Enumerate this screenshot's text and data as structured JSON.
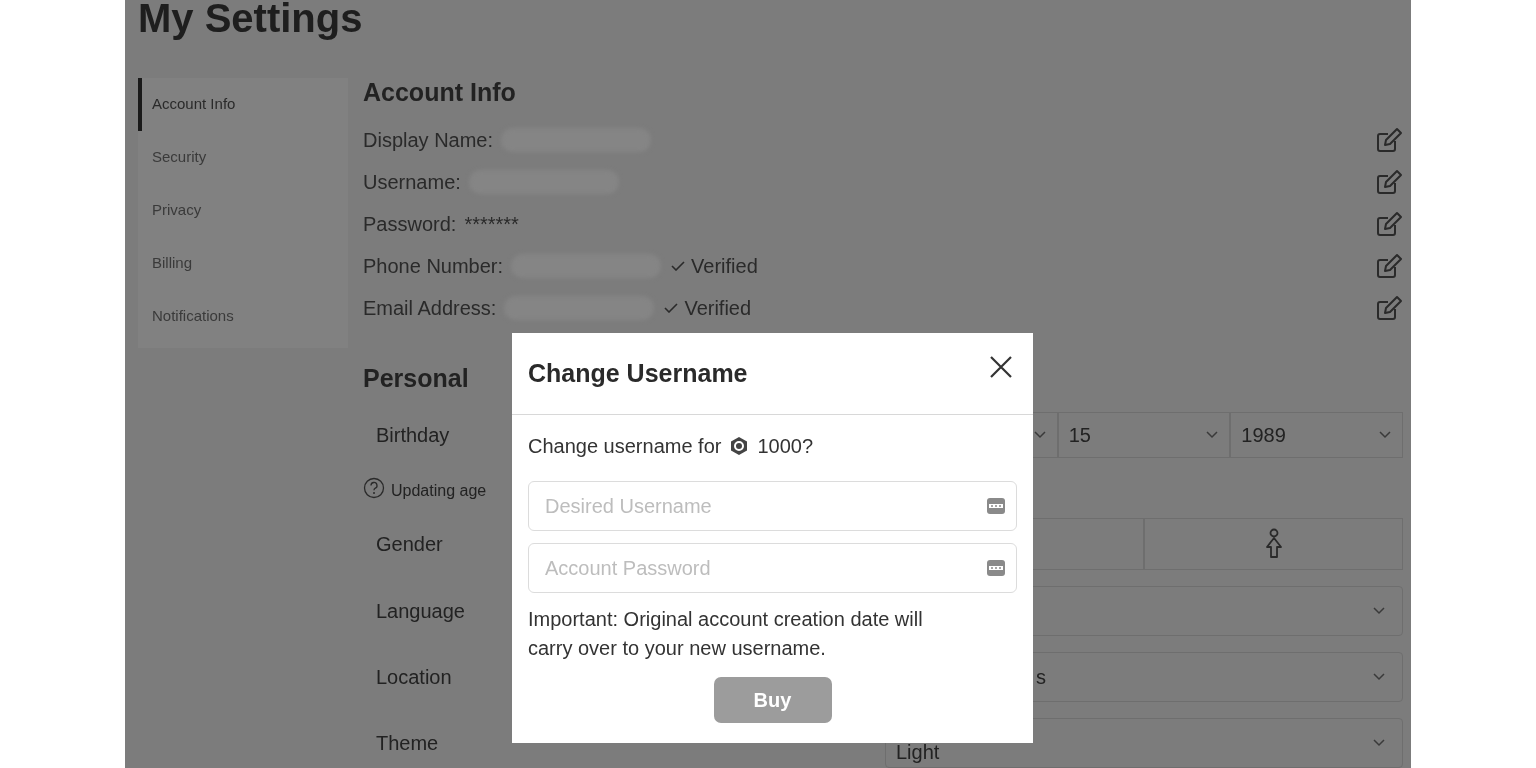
{
  "page_title": "My Settings",
  "sidebar": {
    "items": [
      {
        "label": "Account Info",
        "selected": true
      },
      {
        "label": "Security",
        "selected": false
      },
      {
        "label": "Privacy",
        "selected": false
      },
      {
        "label": "Billing",
        "selected": false
      },
      {
        "label": "Notifications",
        "selected": false
      }
    ]
  },
  "account_info": {
    "title": "Account Info",
    "rows": [
      {
        "label": "Display Name:",
        "kind": "blurred"
      },
      {
        "label": "Username:",
        "kind": "blurred"
      },
      {
        "label": "Password:",
        "kind": "text",
        "value": "*******"
      },
      {
        "label": "Phone Number:",
        "kind": "blurred",
        "verified": "Verified"
      },
      {
        "label": "Email Address:",
        "kind": "blurred",
        "verified": "Verified"
      }
    ]
  },
  "personal": {
    "title": "Personal",
    "birthday": {
      "label": "Birthday",
      "dropdowns": [
        {
          "kind": "empty"
        },
        {
          "kind": "value",
          "value": "15"
        },
        {
          "kind": "value",
          "value": "1989"
        }
      ],
      "hint": "Updating age"
    },
    "gender": {
      "label": "Gender",
      "options": [
        {
          "kind": "covered"
        },
        {
          "kind": "female"
        }
      ]
    },
    "rows": [
      {
        "label": "Language"
      },
      {
        "label": "Location",
        "value": "s"
      },
      {
        "label": "Theme",
        "value": "Light"
      }
    ]
  },
  "modal": {
    "title": "Change Username",
    "prompt": "Change username for",
    "price": "1000?",
    "fields": [
      {
        "placeholder": "Desired Username"
      },
      {
        "placeholder": "Account Password"
      }
    ],
    "note": "Important: Original account creation date will carry over to your new username.",
    "button": {
      "label": "Buy",
      "disabled": true
    }
  }
}
